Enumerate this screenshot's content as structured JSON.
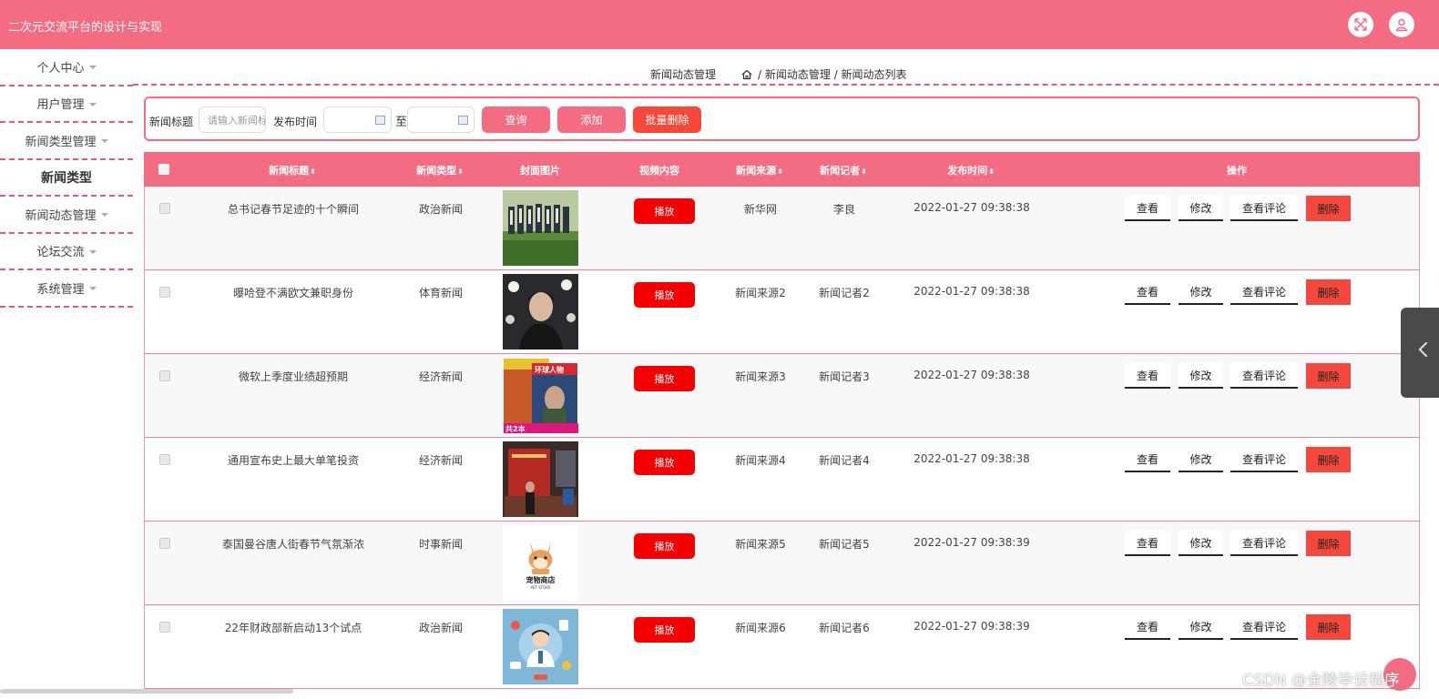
{
  "app": {
    "title": "二次元交流平台的设计与实现"
  },
  "sidebar": {
    "items": [
      {
        "label": "个人中心",
        "caret": true
      },
      {
        "label": "用户管理",
        "caret": true
      },
      {
        "label": "新闻类型管理",
        "caret": true
      },
      {
        "label": "新闻类型",
        "caret": false,
        "active": true
      },
      {
        "label": "新闻动态管理",
        "caret": true
      },
      {
        "label": "论坛交流",
        "caret": true
      },
      {
        "label": "系统管理",
        "caret": true
      }
    ]
  },
  "breadcrumb": {
    "current": "新闻动态管理",
    "path": "/ 新闻动态管理 / 新闻动态列表"
  },
  "search": {
    "title_label": "新闻标题",
    "title_placeholder": "请输入新闻标题",
    "time_label": "发布时间",
    "to_label": "至",
    "query": "查询",
    "add": "添加",
    "batch_delete": "批量删除"
  },
  "table": {
    "headers": {
      "title": "新闻标题",
      "type": "新闻类型",
      "cover": "封面图片",
      "video": "视频内容",
      "source": "新闻来源",
      "reporter": "新闻记者",
      "time": "发布时间",
      "ops": "操作"
    },
    "play_label": "播放",
    "ops": {
      "view": "查看",
      "edit": "修改",
      "comments": "查看评论",
      "delete": "删除"
    },
    "rows": [
      {
        "title": "总书记春节足迹的十个瞬间",
        "type": "政治新闻",
        "source": "新华网",
        "reporter": "李良",
        "time": "2022-01-27 09:38:38",
        "cover": "people-field"
      },
      {
        "title": "曝哈登不满欧文兼职身份",
        "type": "体育新闻",
        "source": "新闻来源2",
        "reporter": "新闻记者2",
        "time": "2022-01-27 09:38:38",
        "cover": "portrait"
      },
      {
        "title": "微软上季度业绩超预期",
        "type": "经济新闻",
        "source": "新闻来源3",
        "reporter": "新闻记者3",
        "time": "2022-01-27 09:38:38",
        "cover": "magazine"
      },
      {
        "title": "通用宣布史上最大单笔投资",
        "type": "经济新闻",
        "source": "新闻来源4",
        "reporter": "新闻记者4",
        "time": "2022-01-27 09:38:38",
        "cover": "stage"
      },
      {
        "title": "泰国曼谷唐人街春节气氛渐浓",
        "type": "时事新闻",
        "source": "新闻来源5",
        "reporter": "新闻记者5",
        "time": "2022-01-27 09:38:39",
        "cover": "pet-store"
      },
      {
        "title": "22年财政部新启动13个试点",
        "type": "政治新闻",
        "source": "新闻来源6",
        "reporter": "新闻记者6",
        "time": "2022-01-27 09:38:39",
        "cover": "doctor"
      }
    ]
  },
  "covers": {
    "magazine_title": "环球人物",
    "magazine_foot": "共2本",
    "pet_store": "宠物商店",
    "pet_store_en": "PET STORE"
  },
  "watermark": "CSDN @金陵毕设程序"
}
